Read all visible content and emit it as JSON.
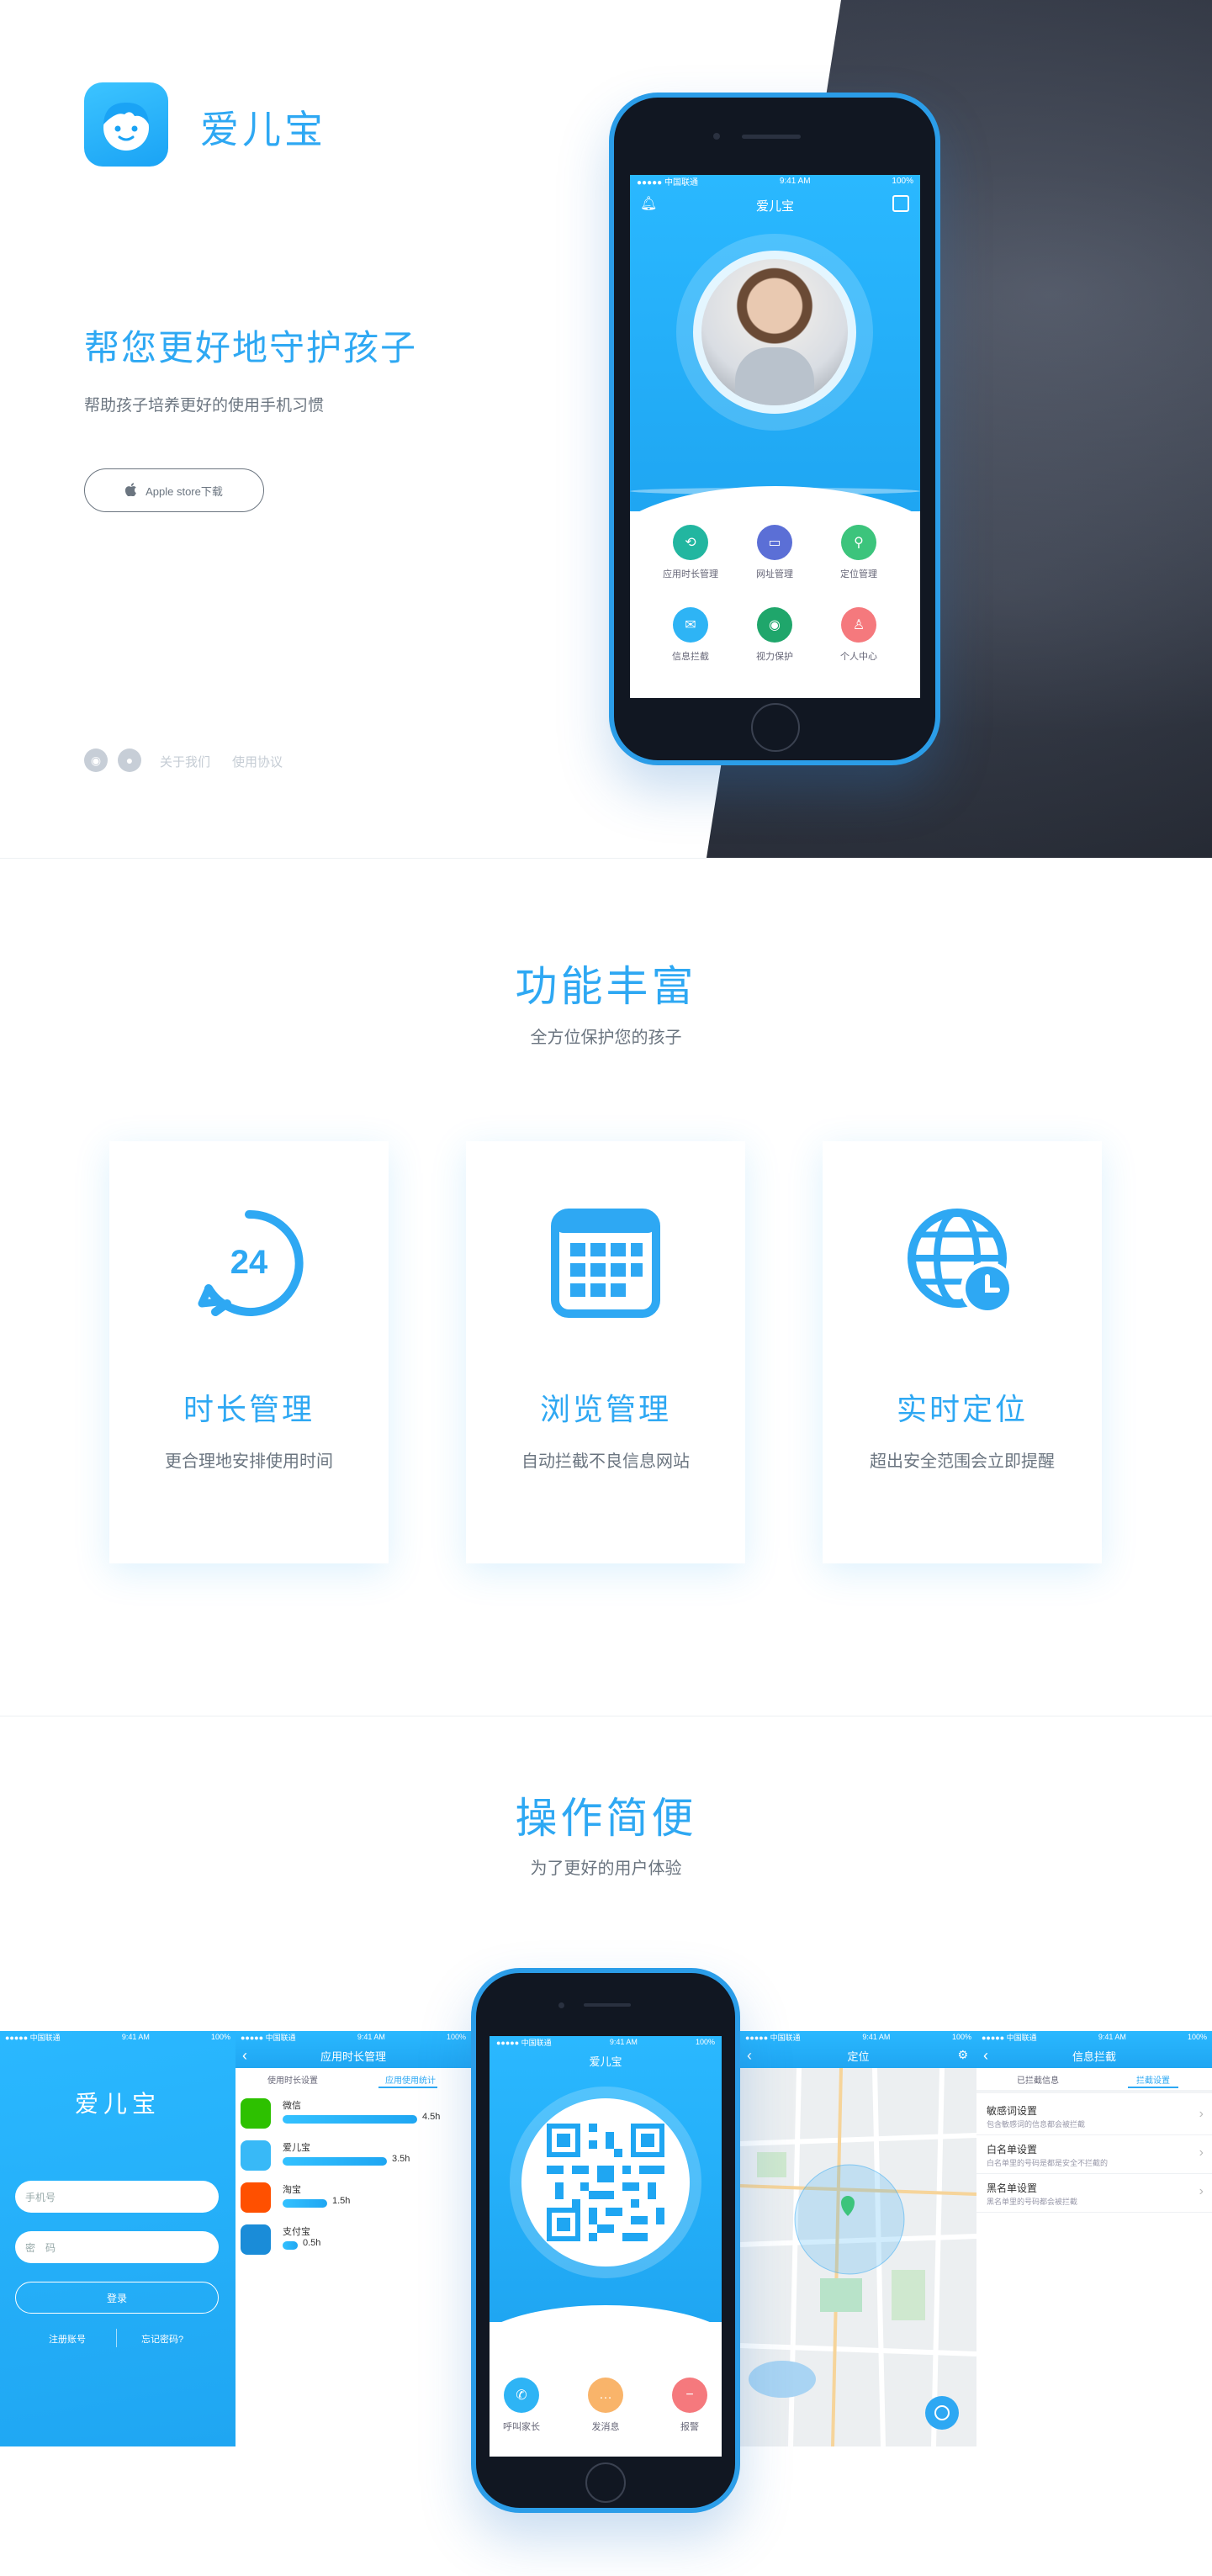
{
  "hero": {
    "brand": "爱儿宝",
    "slogan": "帮您更好地守护孩子",
    "subtitle": "帮助孩子培养更好的使用手机习惯",
    "store_button": "Apple store下载",
    "footer_links": [
      "关于我们",
      "使用协议"
    ],
    "phone": {
      "carrier": "●●●●● 中国联通",
      "time": "9:41 AM",
      "battery": "100%",
      "title": "爱儿宝",
      "apps": [
        {
          "label": "应用时长管理",
          "color": "#22b6a0",
          "icon": "clock-icon"
        },
        {
          "label": "网址管理",
          "color": "#5b6fd6",
          "icon": "monitor-icon"
        },
        {
          "label": "定位管理",
          "color": "#3cc47c",
          "icon": "pin-icon"
        },
        {
          "label": "信息拦截",
          "color": "#2eb4f5",
          "icon": "mail-icon"
        },
        {
          "label": "视力保护",
          "color": "#1fa66b",
          "icon": "eye-icon"
        },
        {
          "label": "个人中心",
          "color": "#f5797d",
          "icon": "person-icon"
        }
      ]
    }
  },
  "features": {
    "title": "功能丰富",
    "subtitle": "全方位保护您的孩子",
    "cards": [
      {
        "title": "时长管理",
        "desc": "更合理地安排使用时间",
        "icon": "clock-24-icon"
      },
      {
        "title": "浏览管理",
        "desc": "自动拦截不良信息网站",
        "icon": "calendar-grid-icon"
      },
      {
        "title": "实时定位",
        "desc": "超出安全范围会立即提醒",
        "icon": "globe-clock-icon"
      }
    ]
  },
  "ease": {
    "title": "操作简便",
    "subtitle": "为了更好的用户体验",
    "login": {
      "brand": "爱儿宝",
      "phone_placeholder": "手机号",
      "password_placeholder": "密　码",
      "login_button": "登录",
      "register": "注册账号",
      "forgot": "忘记密码?"
    },
    "usage": {
      "title": "应用时长管理",
      "tabs": [
        "使用时长设置",
        "应用使用统计"
      ],
      "apps": [
        {
          "name": "微信",
          "value": "4.5h",
          "hours": 4.5,
          "color": "#2dc100"
        },
        {
          "name": "爱儿宝",
          "value": "3.5h",
          "hours": 3.5,
          "color": "#38b9f7"
        },
        {
          "name": "淘宝",
          "value": "1.5h",
          "hours": 1.5,
          "color": "#ff5000"
        },
        {
          "name": "支付宝",
          "value": "0.5h",
          "hours": 0.5,
          "color": "#1a8cd8"
        }
      ]
    },
    "qr_phone": {
      "title": "爱儿宝",
      "actions": [
        {
          "label": "呼叫家长",
          "color": "#2eb4f5",
          "icon": "phone-icon"
        },
        {
          "label": "发消息",
          "color": "#f9b46a",
          "icon": "message-icon"
        },
        {
          "label": "报警",
          "color": "#f5797d",
          "icon": "alarm-icon"
        }
      ]
    },
    "location": {
      "title": "定位"
    },
    "intercept": {
      "title": "信息拦截",
      "tabs": [
        "已拦截信息",
        "拦截设置"
      ],
      "items": [
        {
          "title": "敏感词设置",
          "desc": "包含敏感词的信息都会被拦截"
        },
        {
          "title": "白名单设置",
          "desc": "白名单里的号码是都是安全不拦截的"
        },
        {
          "title": "黑名单设置",
          "desc": "黑名单里的号码都会被拦截"
        }
      ]
    }
  }
}
